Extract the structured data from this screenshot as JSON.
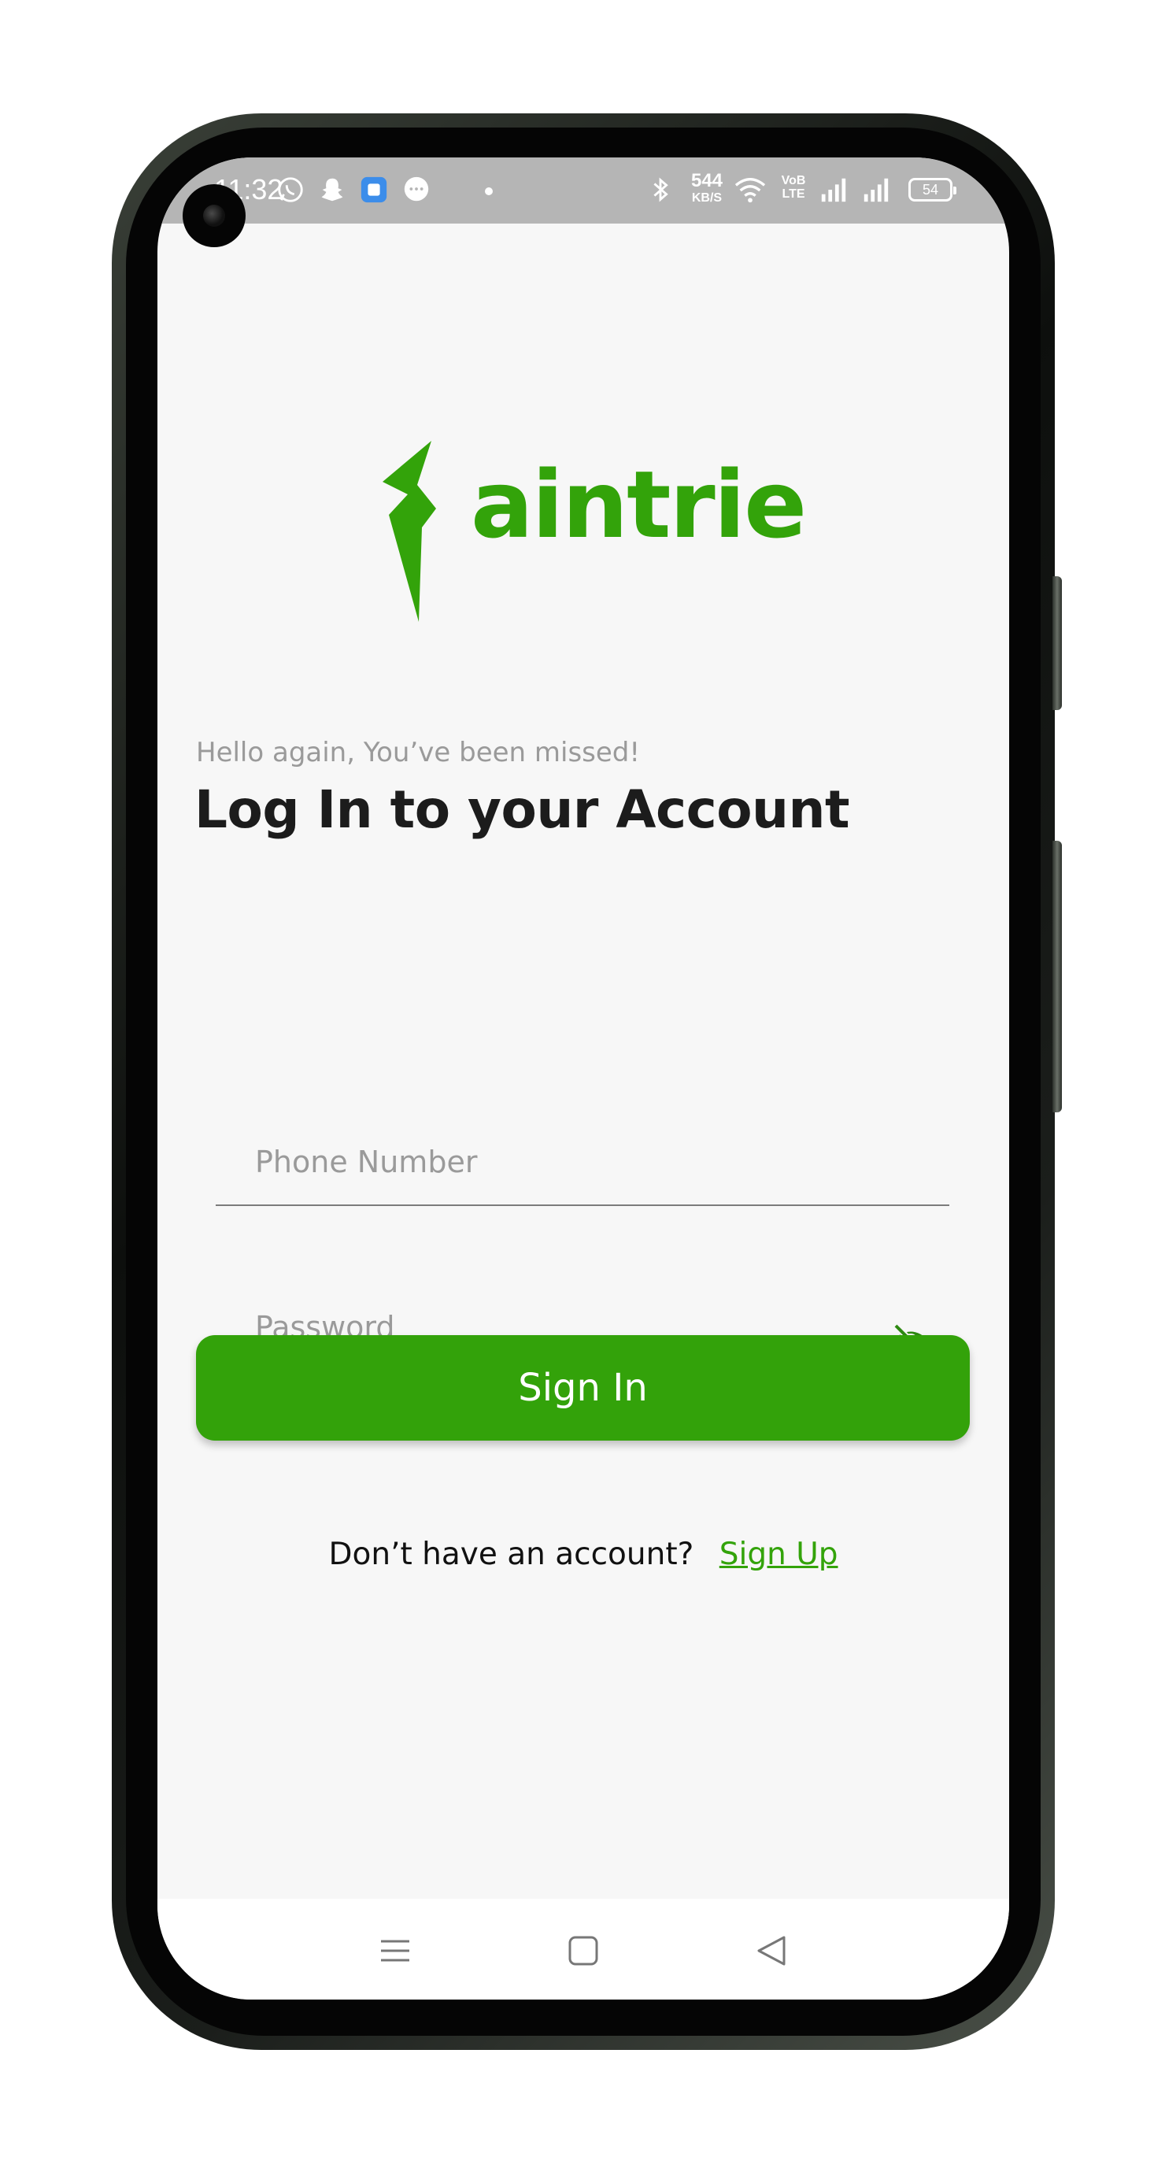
{
  "status_bar": {
    "time": "11:32",
    "net_speed_value": "544",
    "net_speed_unit": "KB/S",
    "volte_line1": "VoB",
    "volte_line2": "LTE",
    "battery": "54",
    "icons": [
      "whatsapp-icon",
      "snapchat-icon",
      "app-icon",
      "messages-icon",
      "dot-icon",
      "bluetooth-icon",
      "wifi-icon",
      "signal-icon",
      "signal-icon",
      "battery-icon"
    ]
  },
  "logo": {
    "text": "aintrie",
    "color": "#33a30a"
  },
  "header": {
    "greeting": "Hello again, You’ve been missed!",
    "title": "Log In to your Account"
  },
  "form": {
    "phone_placeholder": "Phone Number",
    "password_placeholder": "Password",
    "password_toggle_icon": "eye-off-icon",
    "submit_label": "Sign In"
  },
  "signup": {
    "prompt": "Don’t have an account?",
    "link_label": "Sign Up"
  },
  "nav": {
    "icons": [
      "menu-icon",
      "home-square-icon",
      "back-triangle-icon"
    ]
  },
  "colors": {
    "accent": "#33a20a",
    "background": "#f7f7f7"
  }
}
